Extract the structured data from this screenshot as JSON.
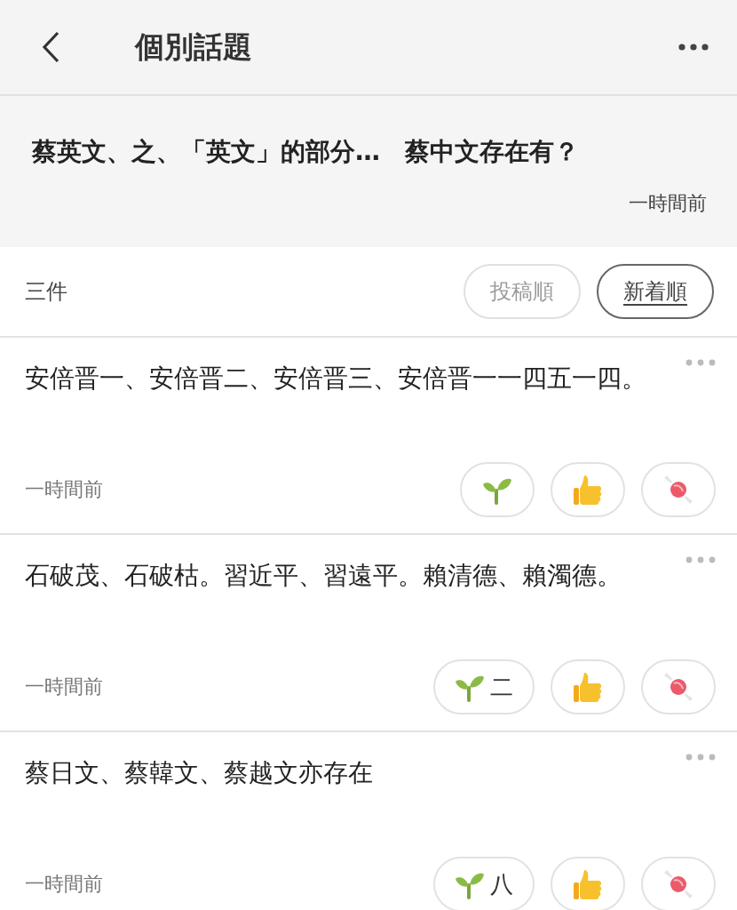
{
  "header": {
    "title": "個別話題"
  },
  "topic": {
    "title": "蔡英文、之、「英文」的部分…　蔡中文存在有？",
    "time": "一時間前"
  },
  "list_bar": {
    "count": "三件",
    "sort_options": [
      {
        "label": "投稿順",
        "selected": false
      },
      {
        "label": "新着順",
        "selected": true
      }
    ]
  },
  "posts": [
    {
      "text": "安倍晋一、安倍晋二、安倍晋三、安倍晋一一四五一四。",
      "time": "一時間前",
      "reactions": [
        {
          "kind": "sprout"
        },
        {
          "kind": "thumb"
        },
        {
          "kind": "candy"
        }
      ]
    },
    {
      "text": "石破茂、石破枯。習近平、習遠平。賴清德、賴濁德。",
      "time": "一時間前",
      "reactions": [
        {
          "kind": "sprout",
          "count": "二"
        },
        {
          "kind": "thumb"
        },
        {
          "kind": "candy"
        }
      ]
    },
    {
      "text": "蔡日文、蔡韓文、蔡越文亦存在",
      "time": "一時間前",
      "reactions": [
        {
          "kind": "sprout",
          "count": "八"
        },
        {
          "kind": "thumb"
        },
        {
          "kind": "candy"
        }
      ]
    }
  ]
}
